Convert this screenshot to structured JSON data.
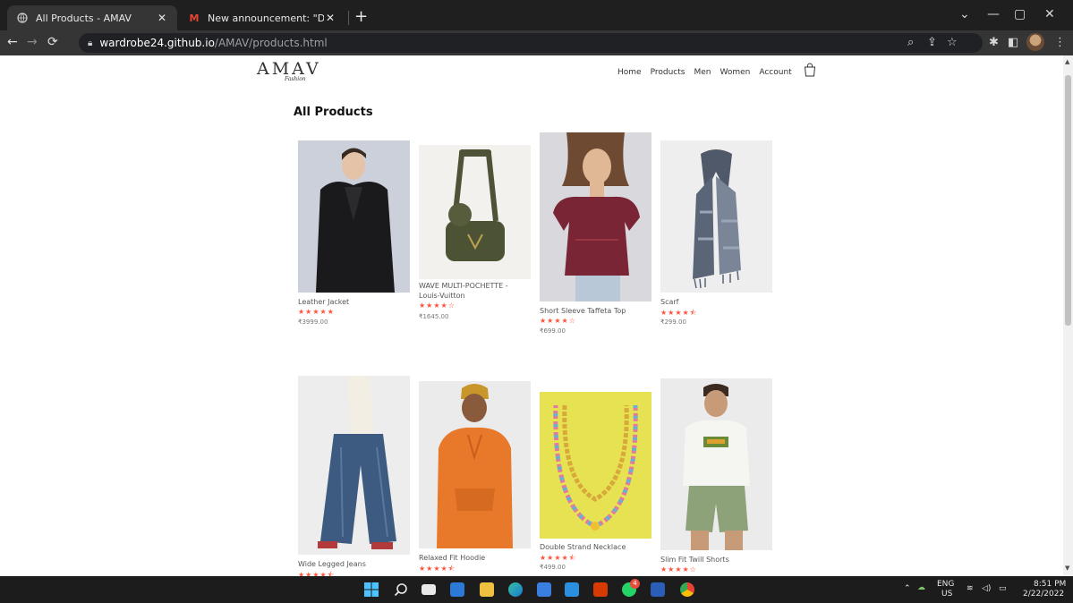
{
  "browser": {
    "tabs": [
      {
        "title": "All Products - AMAV",
        "active": true
      },
      {
        "title": "New announcement: \"Dear stude",
        "active": false
      }
    ],
    "new_tab": "+",
    "url_host": "wardrobe24.github.io",
    "url_path": "/AMAV/products.html",
    "window_controls": [
      "⌄",
      "—",
      "▢",
      "✕"
    ]
  },
  "site": {
    "logo": "AMAV",
    "logo_sub": "Fashion",
    "nav": [
      "Home",
      "Products",
      "Men",
      "Women",
      "Account"
    ],
    "heading": "All Products"
  },
  "products": [
    {
      "name": "Leather Jacket",
      "rating": 5,
      "stars": "★★★★★",
      "price": "₹3999.00"
    },
    {
      "name": "WAVE MULTI-POCHETTE -",
      "name2": "Louis-Vuitton",
      "rating": 4,
      "stars": "★★★★☆",
      "price": "₹1645.00"
    },
    {
      "name": "Short Sleeve Taffeta Top",
      "rating": 4,
      "stars": "★★★★☆",
      "price": "₹699.00"
    },
    {
      "name": "Scarf",
      "rating": 4.5,
      "stars": "★★★★⯪",
      "price": "₹299.00"
    },
    {
      "name": "Wide Legged Jeans",
      "rating": 4.5,
      "stars": "★★★★⯪",
      "price": ""
    },
    {
      "name": "Relaxed Fit Hoodie",
      "rating": 4.5,
      "stars": "★★★★⯪",
      "price": ""
    },
    {
      "name": "Double Strand Necklace",
      "rating": 4.5,
      "stars": "★★★★⯪",
      "price": "₹499.00"
    },
    {
      "name": "Slim Fit Twill Shorts",
      "rating": 4,
      "stars": "★★★★☆",
      "price": ""
    }
  ],
  "taskbar": {
    "lang": "ENG",
    "region": "US",
    "time": "8:51 PM",
    "date": "2/22/2022",
    "whatsapp_badge": "4"
  },
  "colors": {
    "star": "#ff523b",
    "chrome_dark": "#1f1f1f",
    "chrome_mid": "#353535"
  }
}
